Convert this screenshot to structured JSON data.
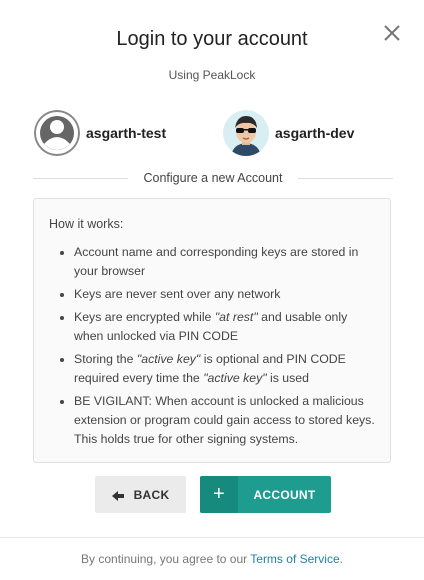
{
  "modal": {
    "title": "Login to your account",
    "subtitle": "Using PeakLock"
  },
  "accounts": [
    {
      "name": "asgarth-test",
      "avatar": "default-avatar-icon"
    },
    {
      "name": "asgarth-dev",
      "avatar": "sunglasses-avatar"
    }
  ],
  "configure_label": "Configure a new Account",
  "info": {
    "heading": "How it works:",
    "items": {
      "i1": "Account name and corresponding keys are stored in your browser",
      "i2": "Keys are never sent over any network",
      "i3a": "Keys are encrypted while ",
      "i3b": "\"at rest\"",
      "i3c": " and usable only when unlocked via PIN CODE",
      "i4a": "Storing the ",
      "i4b": "\"active key\"",
      "i4c": " is optional and PIN CODE required every time the ",
      "i4d": "\"active key\"",
      "i4e": " is used",
      "i5": "BE VIGILANT: When account is unlocked a malicious extension or program could gain access to stored keys. This holds true for other signing systems."
    }
  },
  "buttons": {
    "back": "BACK",
    "account": "ACCOUNT",
    "account_icon": "+"
  },
  "footer": {
    "text": "By continuing, you agree to our ",
    "link": "Terms of Service",
    "end": "."
  },
  "colors": {
    "accent": "#1e9c8f",
    "accent_dark": "#178a7e",
    "link": "#1e84a8"
  }
}
